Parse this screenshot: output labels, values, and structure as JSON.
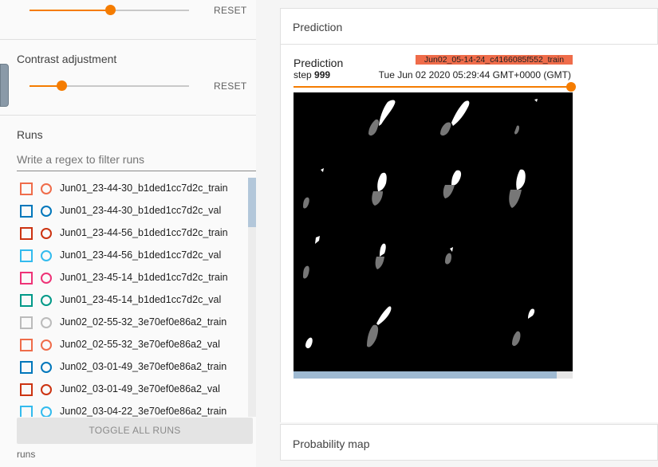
{
  "sidebar": {
    "brightness": {
      "reset_label": "RESET",
      "value": 0.5
    },
    "contrast": {
      "title": "Contrast adjustment",
      "reset_label": "RESET",
      "value": 0.2
    },
    "runs": {
      "title": "Runs",
      "filter_placeholder": "Write a regex to filter runs",
      "items": [
        {
          "label": "Jun01_23-44-30_b1ded1cc7d2c_train",
          "color": "#ef6c4a"
        },
        {
          "label": "Jun01_23-44-30_b1ded1cc7d2c_val",
          "color": "#0077bb"
        },
        {
          "label": "Jun01_23-44-56_b1ded1cc7d2c_train",
          "color": "#cc3311"
        },
        {
          "label": "Jun01_23-44-56_b1ded1cc7d2c_val",
          "color": "#33bbee"
        },
        {
          "label": "Jun01_23-45-14_b1ded1cc7d2c_train",
          "color": "#ee3377"
        },
        {
          "label": "Jun01_23-45-14_b1ded1cc7d2c_val",
          "color": "#009988"
        },
        {
          "label": "Jun02_02-55-32_3e70ef0e86a2_train",
          "color": "#bbbbbb"
        },
        {
          "label": "Jun02_02-55-32_3e70ef0e86a2_val",
          "color": "#ef6c4a"
        },
        {
          "label": "Jun02_03-01-49_3e70ef0e86a2_train",
          "color": "#0077bb"
        },
        {
          "label": "Jun02_03-01-49_3e70ef0e86a2_val",
          "color": "#cc3311"
        },
        {
          "label": "Jun02_03-04-22_3e70ef0e86a2_train",
          "color": "#33bbee"
        }
      ],
      "toggle_label": "TOGGLE ALL RUNS",
      "footer": "runs"
    }
  },
  "main": {
    "prediction_card": {
      "title": "Prediction"
    },
    "image_card": {
      "title": "Prediction",
      "step_label": "step",
      "step_value": "999",
      "run_chip": "Jun02_05-14-24_c4166085f552_train",
      "run_chip_color": "#ef6c4a",
      "timestamp": "Tue Jun 02 2020 05:29:44 GMT+0000 (GMT)",
      "step_slider_value": 1.0
    },
    "probability_card": {
      "title": "Probability map"
    }
  }
}
